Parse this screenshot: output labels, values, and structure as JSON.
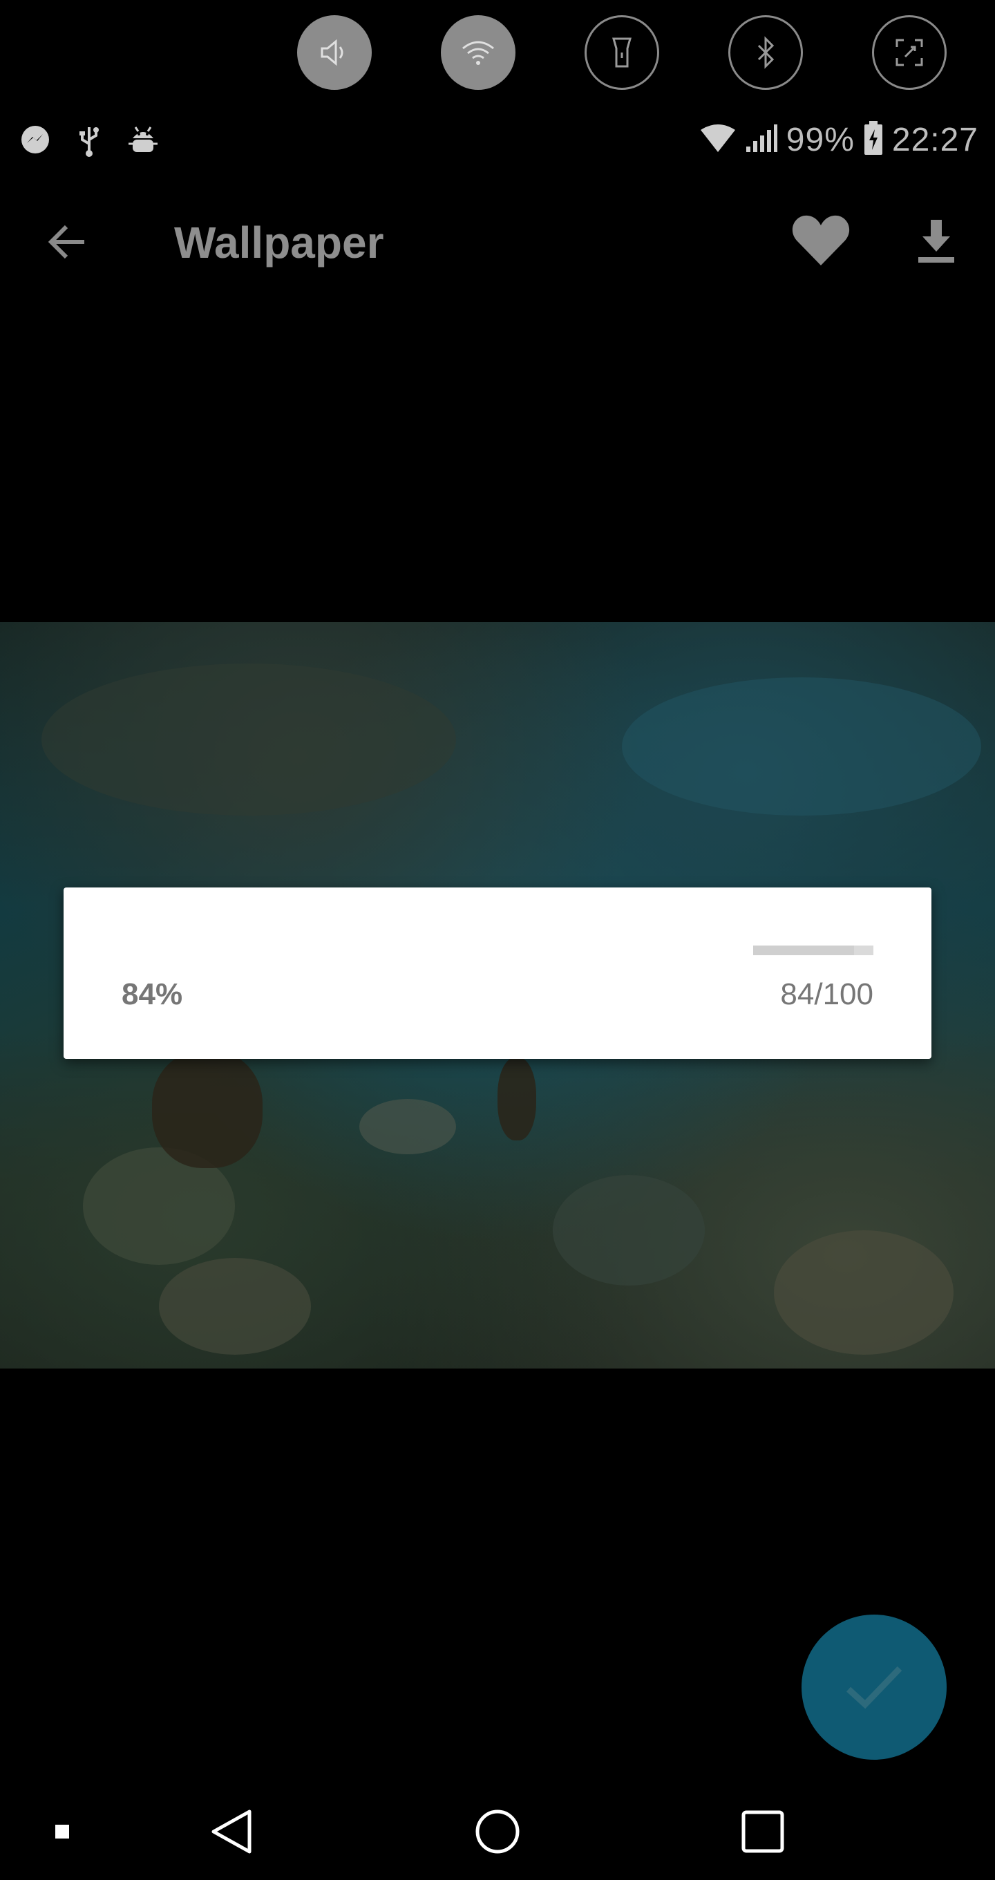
{
  "quick_settings": {
    "toggles": [
      {
        "icon": "volume-icon",
        "active": true
      },
      {
        "icon": "wifi-icon",
        "active": true
      },
      {
        "icon": "flashlight-icon",
        "active": false
      },
      {
        "icon": "bluetooth-icon",
        "active": false
      },
      {
        "icon": "screenshot-icon",
        "active": false
      }
    ]
  },
  "status_bar": {
    "left_icons": [
      "messenger-icon",
      "usb-icon",
      "android-debug-icon"
    ],
    "battery_percent": "99%",
    "time": "22:27"
  },
  "app_bar": {
    "title": "Wallpaper"
  },
  "progress_dialog": {
    "percent_label": "84%",
    "count_label": "84/100",
    "progress": 0.84
  },
  "colors": {
    "fab": "#0f5a73",
    "dialog_bg": "#ffffff",
    "title_text": "#8e8e8e"
  }
}
